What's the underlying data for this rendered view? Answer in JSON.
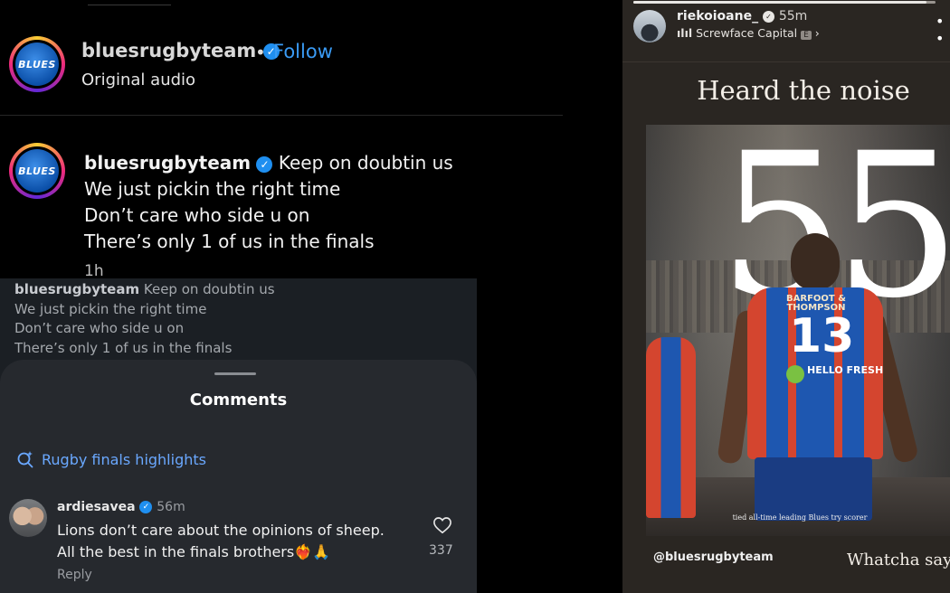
{
  "reel": {
    "username": "bluesrugbyteam",
    "follow_label": "Follow",
    "separator": "•",
    "audio_label": "Original audio",
    "logo_text": "BLUES",
    "caption": {
      "username": "bluesrugbyteam",
      "lines": [
        "Keep on doubtin us",
        "We just pickin the right time",
        "Don’t care who side u on",
        "There’s only 1 of us in the finals"
      ],
      "time": "1h"
    }
  },
  "preview_caption": {
    "username": "bluesrugbyteam",
    "lines": [
      "Keep on doubtin us",
      "We just pickin the right time",
      "Don’t care who side u on",
      "There’s only 1 of us in the finals"
    ]
  },
  "comments_sheet": {
    "title": "Comments",
    "search_suggestion": "Rugby finals highlights",
    "comment": {
      "username": "ardiesavea",
      "time": "56m",
      "line1": "Lions don’t care about the opinions of sheep.",
      "line2": "All the best in the finals brothers❤️‍🔥🙏",
      "likes": "337",
      "reply_label": "Reply"
    }
  },
  "story": {
    "username": "riekoioane_",
    "time": "55m",
    "music": "Screwface Capital",
    "explicit_badge": "E",
    "heading": "Heard the noise",
    "big_number": "55",
    "jersey_sponsor": "BARFOOT & THOMPSON",
    "jersey_number": "13",
    "jersey_badge": "HELLO FRESH",
    "photo_caption": "tied all-time leading Blues try scorer",
    "mention": "@bluesrugbyteam",
    "overlay_text": "Whatcha sayi",
    "progress": 0.97
  },
  "icons": {
    "verified": "verified-badge-icon",
    "search": "sparkle-search-icon",
    "heart": "heart-icon",
    "more": "more-icon",
    "music": "music-bars-icon"
  }
}
